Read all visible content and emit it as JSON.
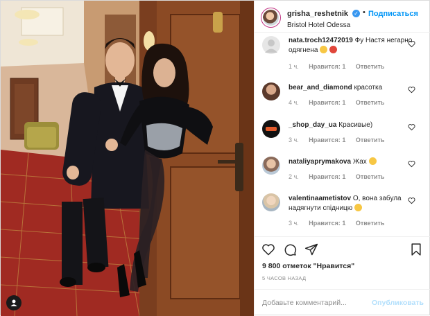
{
  "header": {
    "username": "grisha_reshetnik",
    "verified_icon": "verified-badge-icon",
    "separator": "•",
    "follow_label": "Подписаться",
    "location": "Bristol Hotel Odessa"
  },
  "comments": [
    {
      "username": "nata.troch12472019",
      "text": "Фу Настя негарно одягнена",
      "emoji": "😁😡",
      "time": "1 ч.",
      "likes": "Нравится: 1",
      "reply": "Ответить"
    },
    {
      "username": "bear_and_diamond",
      "text": "красотка",
      "emoji": "",
      "time": "4 ч.",
      "likes": "Нравится: 1",
      "reply": "Ответить"
    },
    {
      "username": "_shop_day_ua",
      "text": "Красивые)",
      "emoji": "",
      "time": "3 ч.",
      "likes": "Нравится: 1",
      "reply": "Ответить"
    },
    {
      "username": "nataliyaprymakova",
      "text": "Жах",
      "emoji": "😔",
      "time": "2 ч.",
      "likes": "Нравится: 1",
      "reply": "Ответить"
    },
    {
      "username": "valentinaametistov",
      "text": "О, вона забула надягнути спідницю",
      "emoji": "😝",
      "time": "3 ч.",
      "likes": "Нравится: 1",
      "reply": "Ответить"
    }
  ],
  "actions": {
    "likes_text": "9 800 отметок \"Нравится\"",
    "time_ago": "5 ЧАСОВ НАЗАД",
    "comment_placeholder": "Добавьте комментарий...",
    "publish_label": "Опубликовать"
  },
  "colors": {
    "accent": "#0095f6",
    "publish_disabled": "#b2dffc",
    "muted": "#8e8e8e"
  }
}
